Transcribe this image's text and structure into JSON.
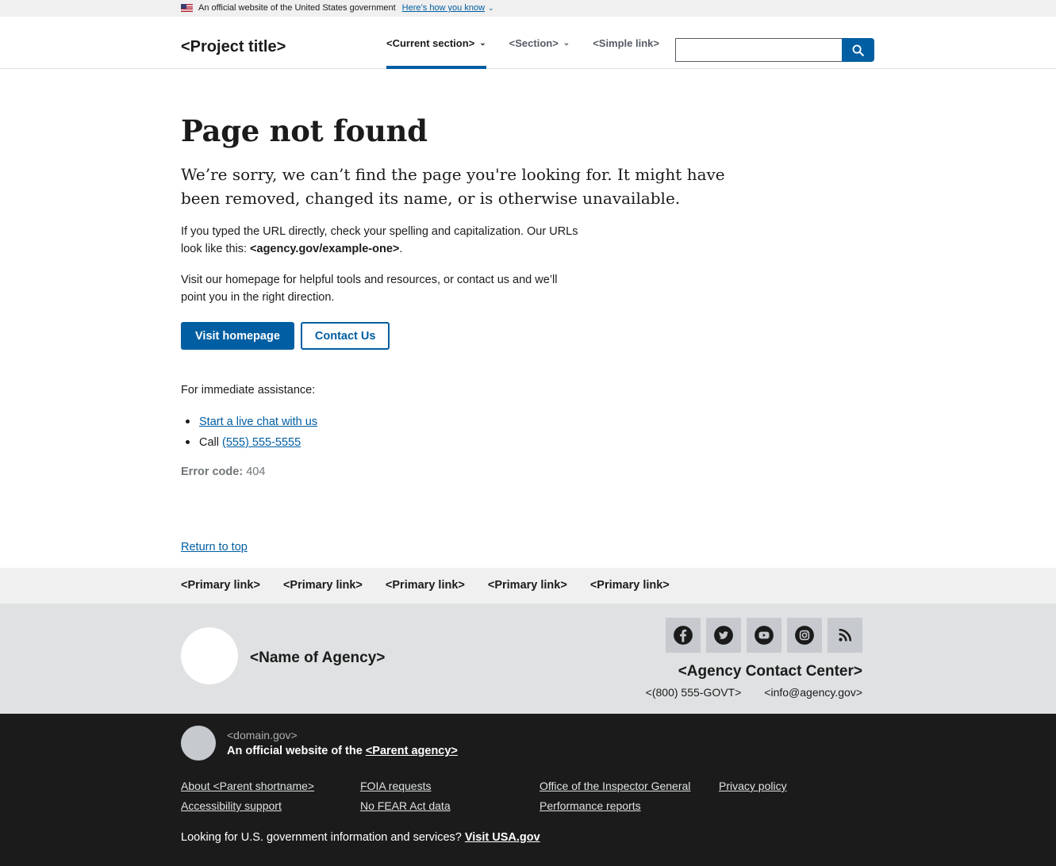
{
  "banner": {
    "text": "An official website of the United States government",
    "link": "Here’s how you know"
  },
  "header": {
    "title": "<Project title>",
    "nav": [
      {
        "label": "<Current section>"
      },
      {
        "label": "<Section>"
      },
      {
        "label": "<Simple link>"
      }
    ],
    "search": {
      "placeholder": ""
    }
  },
  "main": {
    "title": "Page not found",
    "lead": "We’re sorry, we can’t find the page you're looking for. It might have been removed, changed its name, or is otherwise unavailable.",
    "p1_prefix": "If you typed the URL directly, check your spelling and capitalization. Our URLs look like this: ",
    "p1_url": "<agency.gov/example-one>",
    "p1_suffix": ".",
    "p2": "Visit our homepage for helpful tools and resources, or contact us and we’ll point you in the right direction.",
    "btn_home": "Visit homepage",
    "btn_contact": "Contact Us",
    "assist_label": "For immediate assistance:",
    "chat_link": "Start a live chat with us",
    "call_prefix": "Call ",
    "call_number": "(555) 555-5555",
    "error_label": "Error code:",
    "error_value": "404",
    "return_top": "Return to top"
  },
  "footer": {
    "primary_links": [
      "<Primary link>",
      "<Primary link>",
      "<Primary link>",
      "<Primary link>",
      "<Primary link>"
    ],
    "agency_name": "<Name of Agency>",
    "socials": [
      "facebook-icon",
      "twitter-icon",
      "youtube-icon",
      "instagram-icon",
      "rss-icon"
    ],
    "contact_center": "<Agency Contact Center>",
    "phone": "<(800) 555-GOVT>",
    "email": "<info@agency.gov>"
  },
  "identifier": {
    "domain": "<domain.gov>",
    "official_prefix": "An official website of the ",
    "parent_agency": "<Parent agency>",
    "links": [
      "About <Parent shortname>",
      "FOIA requests",
      "Office of the Inspector General",
      "Privacy policy",
      "Accessibility support",
      "No FEAR Act data",
      "Performance reports"
    ],
    "usa_prefix": "Looking for U.S. government information and services? ",
    "usa_link": "Visit USA.gov"
  },
  "colors": {
    "primary": "#005ea2",
    "footer_dark": "#1b1b1b",
    "footer_gray": "#dfe1e2",
    "footer_light": "#f0f0f0"
  }
}
